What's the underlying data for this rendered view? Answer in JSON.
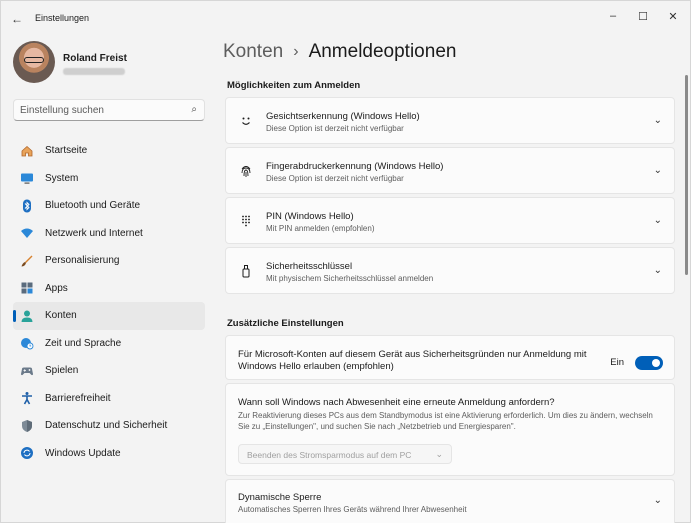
{
  "window": {
    "title": "Einstellungen"
  },
  "profile": {
    "name": "Roland Freist"
  },
  "search": {
    "placeholder": "Einstellung suchen"
  },
  "sidebar": {
    "items": [
      {
        "label": "Startseite",
        "icon": "home-icon"
      },
      {
        "label": "System",
        "icon": "monitor-icon"
      },
      {
        "label": "Bluetooth und Geräte",
        "icon": "bluetooth-icon"
      },
      {
        "label": "Netzwerk und Internet",
        "icon": "wifi-icon"
      },
      {
        "label": "Personalisierung",
        "icon": "brush-icon"
      },
      {
        "label": "Apps",
        "icon": "apps-icon"
      },
      {
        "label": "Konten",
        "icon": "person-icon",
        "active": true
      },
      {
        "label": "Zeit und Sprache",
        "icon": "globe-clock-icon"
      },
      {
        "label": "Spielen",
        "icon": "gamepad-icon"
      },
      {
        "label": "Barrierefreiheit",
        "icon": "accessibility-icon"
      },
      {
        "label": "Datenschutz und Sicherheit",
        "icon": "shield-icon"
      },
      {
        "label": "Windows Update",
        "icon": "sync-icon"
      }
    ]
  },
  "breadcrumb": {
    "parent": "Konten",
    "current": "Anmeldeoptionen"
  },
  "sections": {
    "signin": "Möglichkeiten zum Anmelden",
    "additional": "Zusätzliche Einstellungen"
  },
  "signin_options": [
    {
      "title": "Gesichtserkennung (Windows Hello)",
      "subtitle": "Diese Option ist derzeit nicht verfügbar",
      "icon": "face-icon"
    },
    {
      "title": "Fingerabdruckerkennung (Windows Hello)",
      "subtitle": "Diese Option ist derzeit nicht verfügbar",
      "icon": "fingerprint-icon"
    },
    {
      "title": "PIN (Windows Hello)",
      "subtitle": "Mit PIN anmelden (empfohlen)",
      "icon": "keypad-icon"
    },
    {
      "title": "Sicherheitsschlüssel",
      "subtitle": "Mit physischem Sicherheitsschlüssel anmelden",
      "icon": "usb-key-icon"
    }
  ],
  "additional": {
    "hello_only": {
      "text": "Für Microsoft-Konten auf diesem Gerät aus Sicherheitsgründen nur Anmeldung mit Windows Hello erlauben (empfohlen)",
      "state_label": "Ein",
      "enabled": true
    },
    "reauth": {
      "title": "Wann soll Windows nach Abwesenheit eine erneute Anmeldung anfordern?",
      "description": "Zur Reaktivierung dieses PCs aus dem Standbymodus ist eine Aktivierung erforderlich. Um dies zu ändern, wechseln Sie zu „Einstellungen\", und suchen Sie nach „Netzbetrieb und Energiesparen\".",
      "dropdown_value": "Beenden des Stromsparmodus auf dem PC"
    },
    "dynamic_lock": {
      "title": "Dynamische Sperre",
      "subtitle": "Automatisches Sperren Ihres Geräts während Ihrer Abwesenheit"
    }
  },
  "colors": {
    "accent": "#005fb8",
    "background": "#f3f3f3",
    "card": "#fbfbfb"
  }
}
